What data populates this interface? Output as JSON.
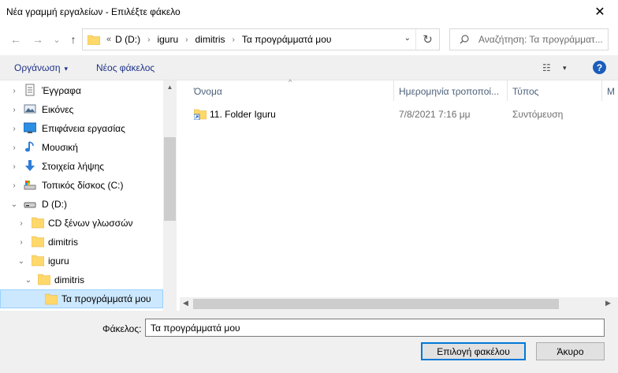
{
  "window": {
    "title": "Νέα γραμμή εργαλείων - Επιλέξτε φάκελο",
    "close_glyph": "✕"
  },
  "nav": {
    "back_glyph": "←",
    "forward_glyph": "→",
    "recent_glyph": "⌄",
    "up_glyph": "↑",
    "overflow": "«",
    "breadcrumbs": [
      "D (D:)",
      "iguru",
      "dimitris",
      "Τα προγράμματά μου"
    ],
    "breadcrumb_separator": "›",
    "dropdown_glyph": "⌄",
    "refresh_glyph": "↻"
  },
  "search": {
    "placeholder": "Αναζήτηση: Τα προγράμματ..."
  },
  "toolbar": {
    "organize_label": "Οργάνωση",
    "dropdown_glyph": "▾",
    "new_folder_label": "Νέος φάκελος",
    "view_glyph": "☷",
    "help_label": "?"
  },
  "tree": {
    "items": [
      {
        "label": "Έγγραφα",
        "icon": "documents-icon",
        "expander": "›"
      },
      {
        "label": "Εικόνες",
        "icon": "pictures-icon",
        "expander": "›"
      },
      {
        "label": "Επιφάνεια εργασίας",
        "icon": "desktop-icon",
        "expander": "›"
      },
      {
        "label": "Μουσική",
        "icon": "music-icon",
        "expander": "›"
      },
      {
        "label": "Στοιχεία λήψης",
        "icon": "downloads-icon",
        "expander": "›"
      },
      {
        "label": "Τοπικός δίσκος (C:)",
        "icon": "local-disk-icon",
        "expander": "›"
      },
      {
        "label": "D (D:)",
        "icon": "drive-icon",
        "expander": "⌄"
      },
      {
        "label": "CD ξένων γλωσσών",
        "icon": "folder-icon",
        "expander": "›"
      },
      {
        "label": "dimitris",
        "icon": "folder-icon",
        "expander": "›"
      },
      {
        "label": "iguru",
        "icon": "folder-icon",
        "expander": "⌄"
      },
      {
        "label": "dimitris",
        "icon": "folder-icon",
        "expander": "⌄"
      },
      {
        "label": "Τα προγράμματά μου",
        "icon": "folder-icon",
        "expander": "",
        "selected": true
      }
    ],
    "scroll_up_glyph": "▲"
  },
  "columns": {
    "name": "Όνομα",
    "date": "Ημερομηνία τροποποί...",
    "type": "Τύπος",
    "size": "Μ",
    "sort_glyph": "^"
  },
  "files": [
    {
      "name": "11. Folder Iguru",
      "date": "7/8/2021 7:16 μμ",
      "type": "Συντόμευση",
      "icon": "folder-shortcut-icon"
    }
  ],
  "hscroll": {
    "left_glyph": "◀",
    "right_glyph": "▶"
  },
  "footer": {
    "folder_label": "Φάκελος:",
    "folder_value": "Τα προγράμματά μου",
    "select_button": "Επιλογή φακέλου",
    "cancel_button": "Άκυρο"
  },
  "colors": {
    "accent": "#0078d7",
    "selection": "#cce8ff",
    "link": "#1e3287",
    "folder": "#ffd86b"
  }
}
